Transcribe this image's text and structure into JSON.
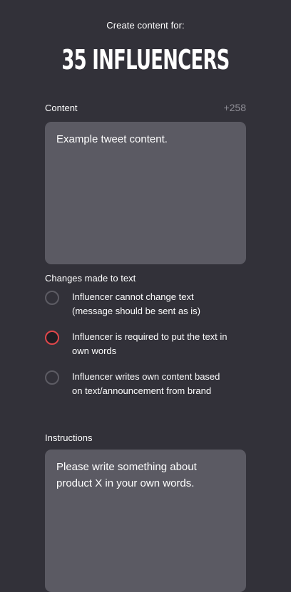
{
  "header": {
    "subtitle": "Create content for:",
    "headline": "35 INFLUENCERS"
  },
  "content_field": {
    "label": "Content",
    "counter": "+258",
    "value": "Example tweet content."
  },
  "changes": {
    "label": "Changes made to text",
    "options": [
      {
        "text": "Influencer cannot change text (message should be sent as is)",
        "selected": false
      },
      {
        "text": "Influencer is required to put the text in own words",
        "selected": true
      },
      {
        "text": "Influencer writes own content based on text/announcement from brand",
        "selected": false
      }
    ]
  },
  "instructions_field": {
    "label": "Instructions",
    "value": "Please write something about product X in your own words."
  },
  "colors": {
    "background": "#323139",
    "field": "#5b5a63",
    "accent_selected": "#e0474b",
    "counter": "#8e8d95"
  }
}
